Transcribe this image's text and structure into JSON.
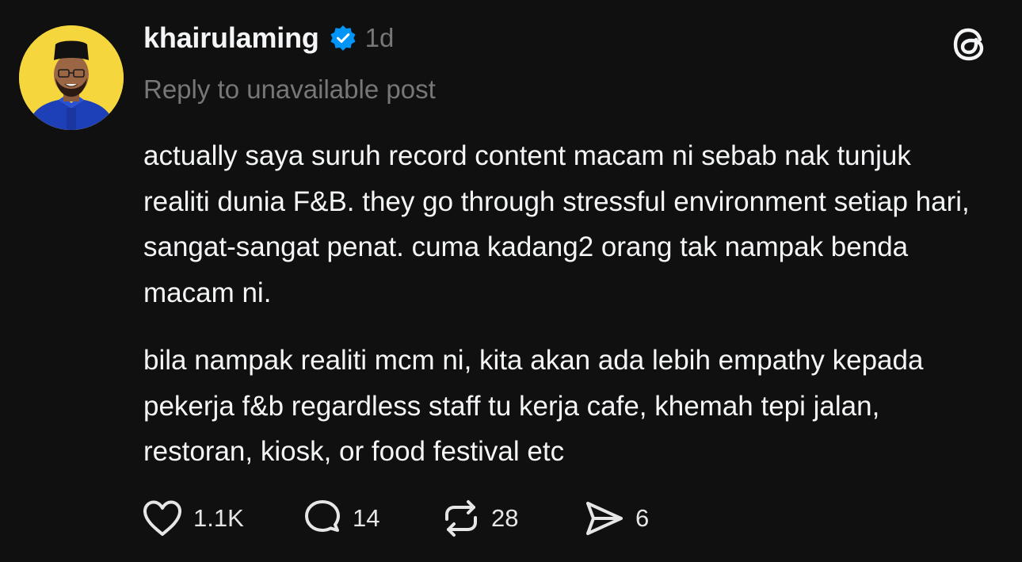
{
  "post": {
    "username": "khairulaming",
    "verified": true,
    "time": "1d",
    "reply_note": "Reply to unavailable post",
    "paragraphs": [
      "actually saya suruh record content macam ni sebab nak tunjuk realiti dunia F&B. they go through stressful environment setiap hari, sangat-sangat penat. cuma kadang2 orang tak nampak benda macam ni.",
      "bila nampak realiti mcm ni, kita akan ada lebih empathy kepada pekerja f&b regardless staff tu kerja cafe, khemah tepi jalan, restoran, kiosk, or food festival etc"
    ],
    "actions": {
      "likes": "1.1K",
      "comments": "14",
      "reposts": "28",
      "shares": "6"
    }
  },
  "icons": {
    "verified": "verified-badge-icon",
    "threads": "threads-logo-icon",
    "like": "heart-icon",
    "comment": "speech-bubble-icon",
    "repost": "repost-icon",
    "share": "send-icon"
  },
  "colors": {
    "background": "#101010",
    "primary_text": "#f3f5f7",
    "secondary_text": "#777777",
    "verified_blue": "#0095f6",
    "avatar_bg": "#f5d63d"
  }
}
